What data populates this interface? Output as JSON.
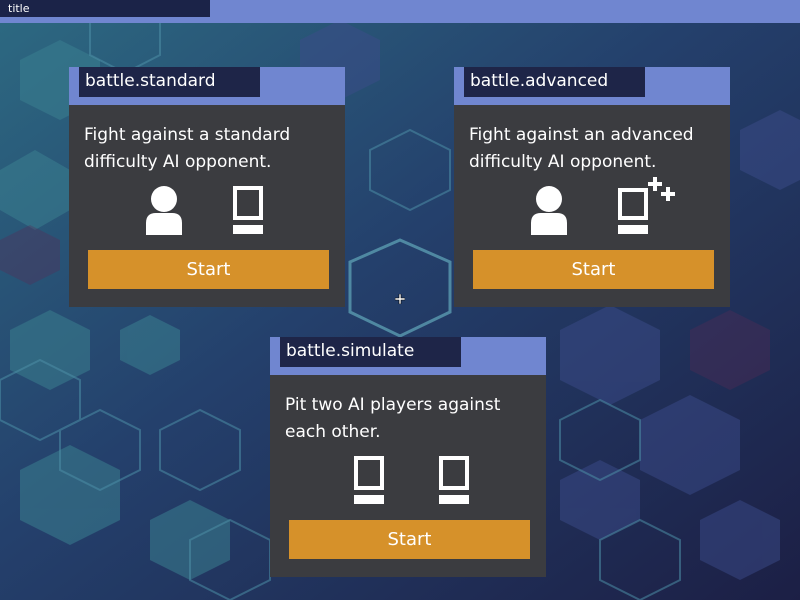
{
  "window": {
    "title": "title"
  },
  "colors": {
    "topbar": "#7086d0",
    "card_bg": "#3b3c40",
    "button": "#d6912a",
    "title_bg": "#1e2548"
  },
  "cards": [
    {
      "title": "battle.standard",
      "description": "Fight against a standard difficulty AI opponent.",
      "icons": [
        "player-icon",
        "ai-computer-icon"
      ],
      "start_label": "Start"
    },
    {
      "title": "battle.advanced",
      "description": "Fight against an advanced difficulty AI opponent.",
      "icons": [
        "player-icon",
        "ai-computer-plus-icon"
      ],
      "start_label": "Start"
    },
    {
      "title": "battle.simulate",
      "description": "Pit two AI players against each other.",
      "icons": [
        "ai-computer-icon",
        "ai-computer-icon"
      ],
      "start_label": "Start"
    }
  ]
}
